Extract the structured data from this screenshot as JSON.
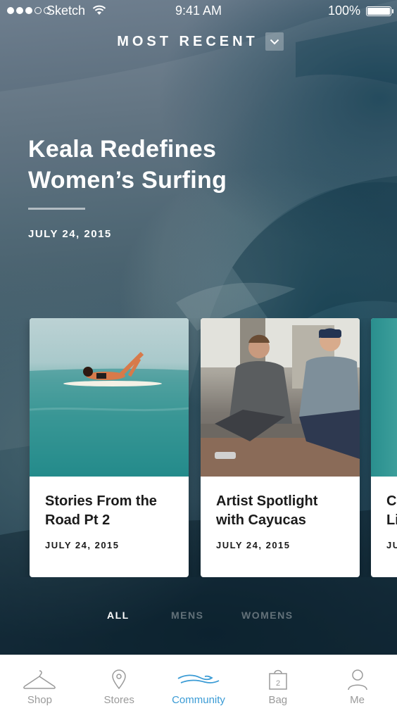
{
  "status_bar": {
    "carrier": "Sketch",
    "time": "9:41 AM",
    "battery": "100%",
    "signal_bars": 3,
    "signal_total": 5
  },
  "header": {
    "filter_label": "MOST RECENT",
    "filter_icon": "chevron-down-icon"
  },
  "featured": {
    "title_line1": "Keala Redefines",
    "title_line2": "Women’s Surfing",
    "date": "JULY 24, 2015"
  },
  "cards": [
    {
      "title_line1": "Stories From the",
      "title_line2": "Road Pt 2",
      "date": "JULY 24, 2015"
    },
    {
      "title_line1": "Artist Spotlight",
      "title_line2": "with Cayucas",
      "date": "JULY 24, 2015"
    },
    {
      "title_line1": "C",
      "title_line2": "Li",
      "date": "JU"
    }
  ],
  "category_tabs": [
    {
      "label": "ALL",
      "active": true
    },
    {
      "label": "MENS",
      "active": false
    },
    {
      "label": "WOMENS",
      "active": false
    }
  ],
  "tab_bar": [
    {
      "label": "Shop",
      "icon": "hanger-icon",
      "active": false
    },
    {
      "label": "Stores",
      "icon": "location-pin-icon",
      "active": false
    },
    {
      "label": "Community",
      "icon": "wave-icon",
      "active": true
    },
    {
      "label": "Bag",
      "icon": "bag-icon",
      "active": false,
      "badge": "2"
    },
    {
      "label": "Me",
      "icon": "person-icon",
      "active": false
    }
  ],
  "colors": {
    "accent": "#3a9bd5",
    "inactive_tab": "#9a9a9a",
    "card_text": "#1b1b1b"
  }
}
